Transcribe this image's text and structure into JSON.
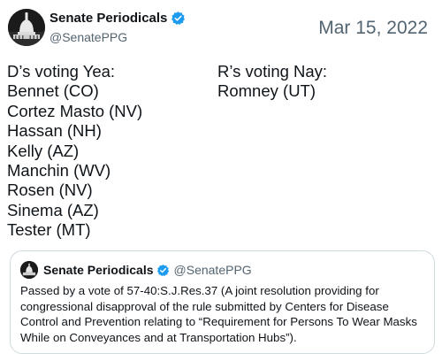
{
  "tweet": {
    "author": {
      "display_name": "Senate Periodicals",
      "handle": "@SenatePPG",
      "verified": true
    },
    "date": "Mar 15, 2022",
    "left_column": {
      "heading": "D’s voting Yea:",
      "names": [
        "Bennet (CO)",
        "Cortez Masto (NV)",
        "Hassan (NH)",
        "Kelly (AZ)",
        "Manchin (WV)",
        "Rosen (NV)",
        "Sinema (AZ)",
        "Tester (MT)"
      ]
    },
    "right_column": {
      "heading": "R’s voting Nay:",
      "names": [
        "Romney (UT)"
      ]
    },
    "quote": {
      "display_name": "Senate Periodicals",
      "handle": "@SenatePPG",
      "text": "Passed by a vote of 57-40:S.J.Res.37 (A joint resolution providing for congressional disapproval of the rule submitted by Centers for Disease Control and Prevention relating to “Requirement for Persons To Wear Masks While on Conveyances and at Transportation Hubs”)."
    }
  },
  "colors": {
    "verified": "#1d9bf0",
    "secondary_text": "#536471",
    "border": "#cfd9de"
  },
  "icons": {
    "avatar": "capitol-dome-icon",
    "verified": "verified-badge-icon"
  }
}
